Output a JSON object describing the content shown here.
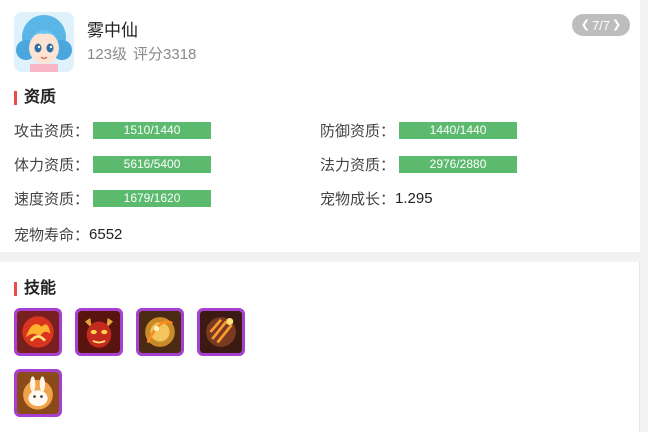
{
  "pet": {
    "name": "雾中仙",
    "level": "123级",
    "score": "评分3318"
  },
  "pager": {
    "text": "7/7",
    "prev_icon": "chevron-left-icon",
    "next_icon": "chevron-right-icon"
  },
  "aptitude": {
    "title": "资质",
    "attack": {
      "label": "攻击资质：",
      "value": "1510/1440"
    },
    "defense": {
      "label": "防御资质：",
      "value": "1440/1440"
    },
    "stamina": {
      "label": "体力资质：",
      "value": "5616/5400"
    },
    "magic": {
      "label": "法力资质：",
      "value": "2976/2880"
    },
    "speed": {
      "label": "速度资质：",
      "value": "1679/1620"
    },
    "growth": {
      "label": "宠物成长：",
      "value": "1.295"
    },
    "lifespan": {
      "label": "宠物寿命：",
      "value": "6552"
    }
  },
  "skills": {
    "title": "技能",
    "items": [
      {
        "icon": "phoenix-fire-skill-icon"
      },
      {
        "icon": "demon-mask-skill-icon"
      },
      {
        "icon": "golden-orb-skill-icon"
      },
      {
        "icon": "fire-claw-skill-icon"
      },
      {
        "icon": "rabbit-skill-icon"
      }
    ]
  },
  "colors": {
    "bar_green": "#5cba6f",
    "section_marker_red": "#e94b4b",
    "skill_border_purple": "#a73fd0",
    "pager_gray": "#bdbdbd"
  }
}
